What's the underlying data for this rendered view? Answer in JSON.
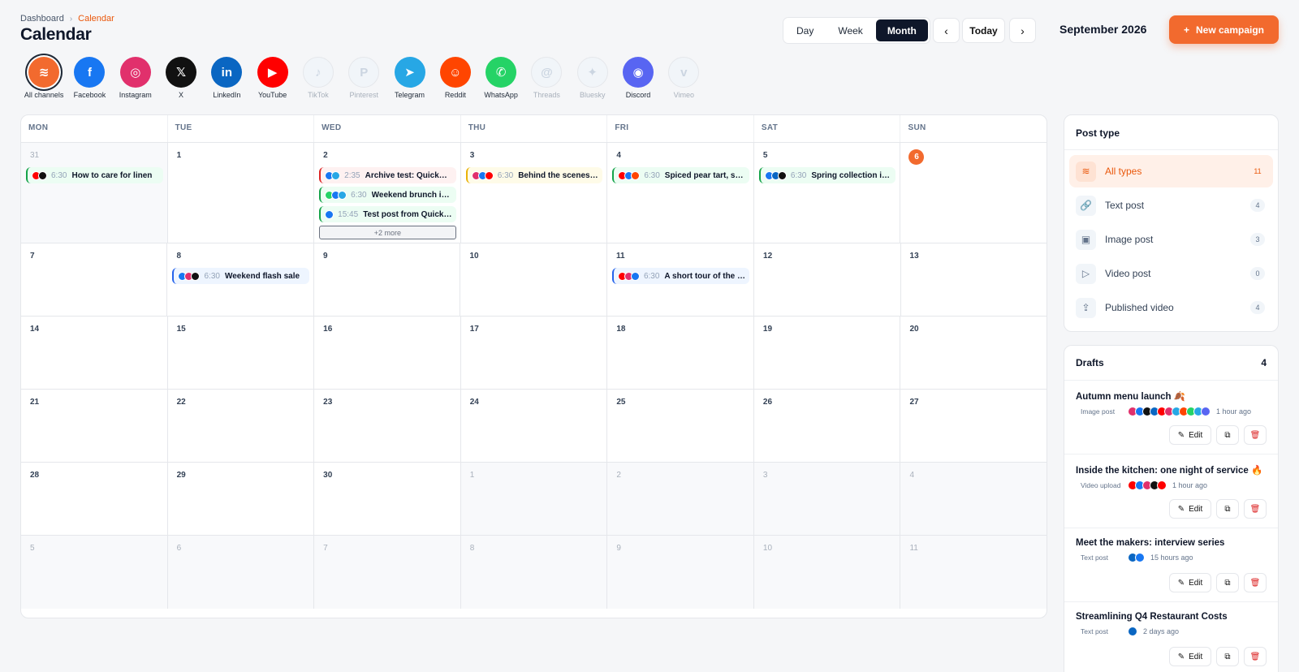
{
  "breadcrumb": {
    "root": "Dashboard",
    "separator": "›",
    "current": "Calendar"
  },
  "page_title": "Calendar",
  "view": {
    "options": [
      "Day",
      "Week",
      "Month"
    ],
    "selected": "Month"
  },
  "nav": {
    "prev": "‹",
    "next": "›",
    "today": "Today"
  },
  "month_label": "September 2026",
  "new_campaign": {
    "icon": "+",
    "label": "New campaign"
  },
  "channels": [
    {
      "label": "All channels",
      "icon": "layers-icon",
      "glyph": "≋",
      "color": "#f26a2e",
      "state": "all"
    },
    {
      "label": "Facebook",
      "icon": "facebook-icon",
      "glyph": "f",
      "color": "#1877f2",
      "state": "on"
    },
    {
      "label": "Instagram",
      "icon": "instagram-icon",
      "glyph": "◎",
      "color": "#e1306c",
      "state": "on"
    },
    {
      "label": "X",
      "icon": "x-icon",
      "glyph": "𝕏",
      "color": "#111111",
      "state": "on"
    },
    {
      "label": "LinkedIn",
      "icon": "linkedin-icon",
      "glyph": "in",
      "color": "#0a66c2",
      "state": "on"
    },
    {
      "label": "YouTube",
      "icon": "youtube-icon",
      "glyph": "▶",
      "color": "#ff0000",
      "state": "on"
    },
    {
      "label": "TikTok",
      "icon": "tiktok-icon",
      "glyph": "♪",
      "color": "#cbd5e1",
      "state": "off"
    },
    {
      "label": "Pinterest",
      "icon": "pinterest-icon",
      "glyph": "P",
      "color": "#cbd5e1",
      "state": "off"
    },
    {
      "label": "Telegram",
      "icon": "telegram-icon",
      "glyph": "➤",
      "color": "#27a7e5",
      "state": "on"
    },
    {
      "label": "Reddit",
      "icon": "reddit-icon",
      "glyph": "☺",
      "color": "#ff4500",
      "state": "on"
    },
    {
      "label": "WhatsApp",
      "icon": "whatsapp-icon",
      "glyph": "✆",
      "color": "#25d366",
      "state": "on"
    },
    {
      "label": "Threads",
      "icon": "threads-icon",
      "glyph": "@",
      "color": "#cbd5e1",
      "state": "off"
    },
    {
      "label": "Bluesky",
      "icon": "bluesky-icon",
      "glyph": "✦",
      "color": "#cbd5e1",
      "state": "off"
    },
    {
      "label": "Discord",
      "icon": "discord-icon",
      "glyph": "◉",
      "color": "#5865f2",
      "state": "on"
    },
    {
      "label": "Vimeo",
      "icon": "vimeo-icon",
      "glyph": "v",
      "color": "#cbd5e1",
      "state": "off"
    }
  ],
  "calendar": {
    "weekdays": [
      "MON",
      "TUE",
      "WED",
      "THU",
      "FRI",
      "SAT",
      "SUN"
    ],
    "weeks": [
      [
        {
          "day": "31",
          "other": true,
          "events": [
            {
              "time": "6:30",
              "title": "How to care for linen",
              "tone": "green",
              "avatars": [
                "#ff0000",
                "#111111"
              ]
            }
          ]
        },
        {
          "day": "1",
          "events": []
        },
        {
          "day": "2",
          "events": [
            {
              "time": "2:35",
              "title": "Archive test: Quick…",
              "tone": "red",
              "avatars": [
                "#1877f2",
                "#27a7e5"
              ]
            },
            {
              "time": "6:30",
              "title": "Weekend brunch i…",
              "tone": "green",
              "avatars": [
                "#25d366",
                "#1877f2",
                "#27a7e5"
              ]
            },
            {
              "time": "15:45",
              "title": "Test post from Quick…",
              "tone": "green",
              "avatars": [
                "#1877f2"
              ]
            }
          ],
          "more": "+2 more"
        },
        {
          "day": "3",
          "events": [
            {
              "time": "6:30",
              "title": "Behind the scenes…",
              "tone": "yellow",
              "avatars": [
                "#e1306c",
                "#1877f2",
                "#ff0000"
              ]
            }
          ]
        },
        {
          "day": "4",
          "events": [
            {
              "time": "6:30",
              "title": "Spiced pear tart, s…",
              "tone": "green",
              "avatars": [
                "#ff0000",
                "#1877f2",
                "#ff4500"
              ]
            }
          ]
        },
        {
          "day": "5",
          "events": [
            {
              "time": "6:30",
              "title": "Spring collection i…",
              "tone": "green",
              "avatars": [
                "#1877f2",
                "#0a66c2",
                "#111111"
              ]
            }
          ]
        },
        {
          "day": "6",
          "today": true,
          "events": []
        }
      ],
      [
        {
          "day": "7",
          "events": []
        },
        {
          "day": "8",
          "events": [
            {
              "time": "6:30",
              "title": "Weekend flash sale",
              "tone": "blue",
              "avatars": [
                "#1877f2",
                "#e1306c",
                "#111111"
              ]
            }
          ]
        },
        {
          "day": "9",
          "events": []
        },
        {
          "day": "10",
          "events": []
        },
        {
          "day": "11",
          "events": [
            {
              "time": "6:30",
              "title": "A short tour of the …",
              "tone": "blue",
              "avatars": [
                "#ff0000",
                "#e1306c",
                "#1877f2"
              ]
            }
          ]
        },
        {
          "day": "12",
          "events": []
        },
        {
          "day": "13",
          "events": []
        }
      ],
      [
        {
          "day": "14",
          "events": []
        },
        {
          "day": "15",
          "events": []
        },
        {
          "day": "16",
          "events": []
        },
        {
          "day": "17",
          "events": []
        },
        {
          "day": "18",
          "events": []
        },
        {
          "day": "19",
          "events": []
        },
        {
          "day": "20",
          "events": []
        }
      ],
      [
        {
          "day": "21",
          "events": []
        },
        {
          "day": "22",
          "events": []
        },
        {
          "day": "23",
          "events": []
        },
        {
          "day": "24",
          "events": []
        },
        {
          "day": "25",
          "events": []
        },
        {
          "day": "26",
          "events": []
        },
        {
          "day": "27",
          "events": []
        }
      ],
      [
        {
          "day": "28",
          "events": []
        },
        {
          "day": "29",
          "events": []
        },
        {
          "day": "30",
          "events": []
        },
        {
          "day": "1",
          "other": true,
          "events": []
        },
        {
          "day": "2",
          "other": true,
          "events": []
        },
        {
          "day": "3",
          "other": true,
          "events": []
        },
        {
          "day": "4",
          "other": true,
          "events": []
        }
      ],
      [
        {
          "day": "5",
          "other": true,
          "events": []
        },
        {
          "day": "6",
          "other": true,
          "events": []
        },
        {
          "day": "7",
          "other": true,
          "events": []
        },
        {
          "day": "8",
          "other": true,
          "events": []
        },
        {
          "day": "9",
          "other": true,
          "events": []
        },
        {
          "day": "10",
          "other": true,
          "events": []
        },
        {
          "day": "11",
          "other": true,
          "events": []
        }
      ]
    ]
  },
  "post_type": {
    "title": "Post type",
    "items": [
      {
        "label": "All types",
        "count": "11",
        "icon": "layers-icon",
        "glyph": "≋",
        "active": true
      },
      {
        "label": "Text post",
        "count": "4",
        "icon": "link-icon",
        "glyph": "🔗"
      },
      {
        "label": "Image post",
        "count": "3",
        "icon": "image-icon",
        "glyph": "▣"
      },
      {
        "label": "Video post",
        "count": "0",
        "icon": "video-icon",
        "glyph": "▷"
      },
      {
        "label": "Published video",
        "count": "4",
        "icon": "upload-icon",
        "glyph": "⇪"
      }
    ]
  },
  "drafts": {
    "title": "Drafts",
    "count": "4",
    "items": [
      {
        "title": "Autumn menu launch 🍂",
        "kind": "Image post",
        "ago": "1 hour ago",
        "avatars": [
          "#e1306c",
          "#1877f2",
          "#111111",
          "#0a66c2",
          "#ff0000",
          "#e1306c",
          "#27a7e5",
          "#ff4500",
          "#25d366",
          "#27a7e5",
          "#5865f2"
        ]
      },
      {
        "title": "Inside the kitchen: one night of service 🔥",
        "kind": "Video upload",
        "ago": "1 hour ago",
        "avatars": [
          "#ff0000",
          "#1877f2",
          "#e1306c",
          "#111111",
          "#ff0000"
        ]
      },
      {
        "title": "Meet the makers: interview series",
        "kind": "Text post",
        "ago": "15 hours ago",
        "avatars": [
          "#0a66c2",
          "#1877f2"
        ]
      },
      {
        "title": "Streamlining Q4 Restaurant Costs",
        "kind": "Text post",
        "ago": "2 days ago",
        "avatars": [
          "#0a66c2"
        ]
      }
    ],
    "edit_label": "Edit",
    "edit_icon": "✎",
    "copy_icon": "⧉",
    "delete_icon": "🗑"
  },
  "colors": {
    "accent": "#f26a2e",
    "dark": "#0f172a",
    "online": "#15803d"
  }
}
